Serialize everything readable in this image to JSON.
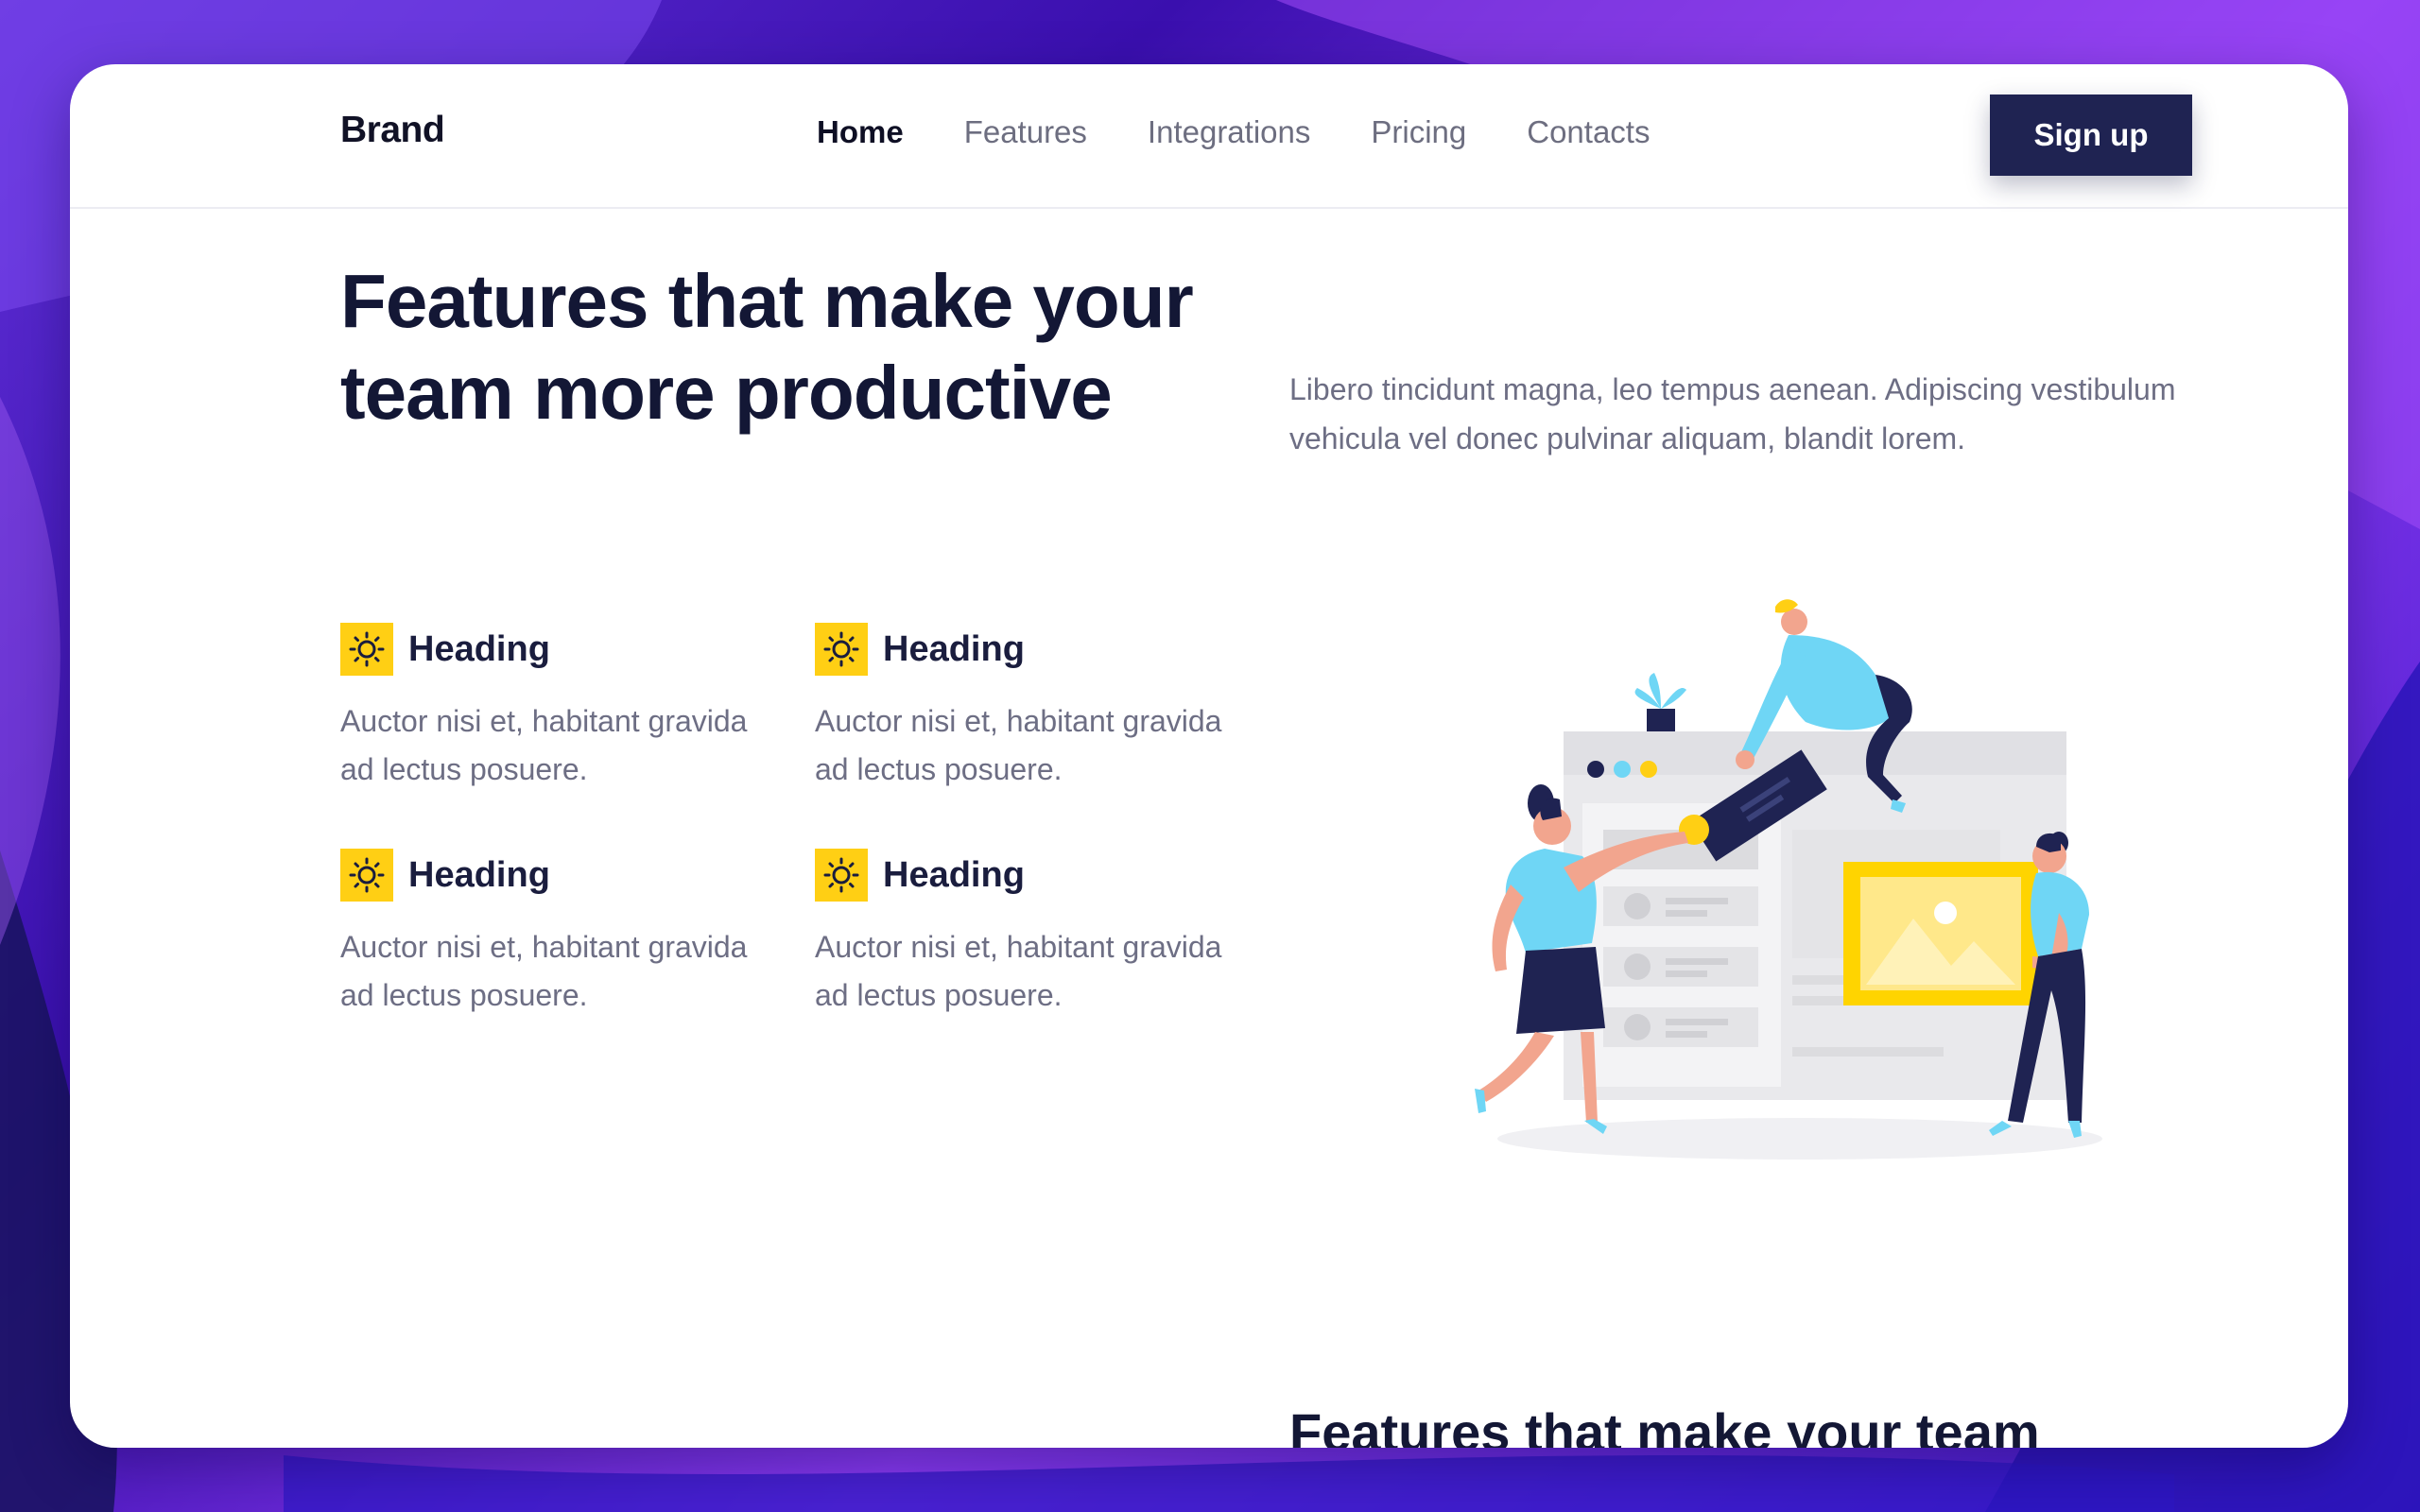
{
  "nav": {
    "brand": "Brand",
    "links": [
      "Home",
      "Features",
      "Integrations",
      "Pricing",
      "Contacts"
    ],
    "active": "Home",
    "signup_label": "Sign up"
  },
  "hero": {
    "title_part1": "Features that make your team more ",
    "title_highlight": "productive",
    "description": "Libero tincidunt magna, leo tempus aenean. Adipiscing vestibulum vehicula vel donec pulvinar aliquam, blandit lorem."
  },
  "features": [
    {
      "icon": "sun-icon",
      "title": "Heading",
      "text": "Auctor nisi et, habitant gravida ad lectus posuere."
    },
    {
      "icon": "sun-icon",
      "title": "Heading",
      "text": "Auctor nisi et, habitant gravida ad lectus posuere."
    },
    {
      "icon": "sun-icon",
      "title": "Heading",
      "text": "Auctor nisi et, habitant gravida ad lectus posuere."
    },
    {
      "icon": "sun-icon",
      "title": "Heading",
      "text": "Auctor nisi et, habitant gravida ad lectus posuere."
    }
  ],
  "section2": {
    "title": "Features that make your team more productive"
  },
  "colors": {
    "navy": "#1f2352",
    "heading": "#131735",
    "accent_yellow": "#ffd400",
    "body_text": "#6d6e84",
    "illustration_blue": "#6fd6f5",
    "background_purple": "#5f2fd6"
  }
}
